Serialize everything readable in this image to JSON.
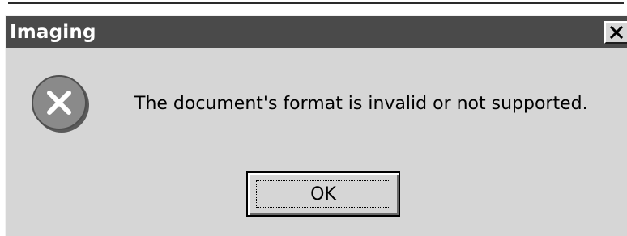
{
  "dialog": {
    "title": "Imaging",
    "message": "The document's format is invalid or not supported.",
    "ok_label": "OK",
    "close_icon": "close-icon",
    "error_icon": "error-icon"
  },
  "colors": {
    "title_bar": "#4a4a4a",
    "dialog_bg": "#d6d6d6",
    "icon_circle": "#8a8a8a"
  }
}
